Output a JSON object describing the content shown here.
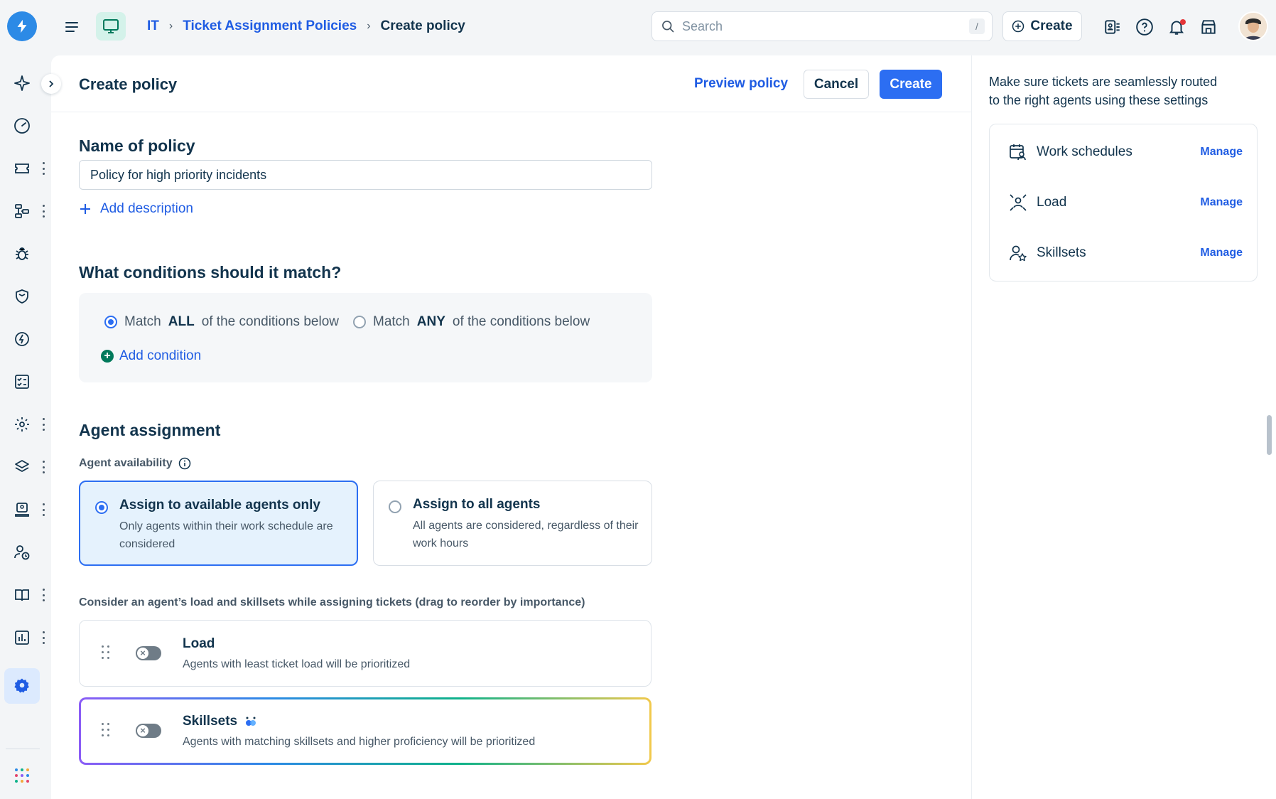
{
  "topbar": {
    "breadcrumb": [
      "IT",
      "Ticket Assignment Policies",
      "Create policy"
    ],
    "search_placeholder": "Search",
    "search_shortcut": "/",
    "create_label": "Create"
  },
  "leftnav": {
    "items": [
      "sparkle-icon",
      "dashboard-icon",
      "ticket-icon",
      "workflow-icon",
      "bug-icon",
      "shield-icon",
      "change-icon",
      "tasks-icon",
      "config-icon",
      "layers-icon",
      "assets-icon",
      "user-clock-icon",
      "book-icon",
      "reports-icon",
      "settings-icon",
      "apps-grid-icon"
    ]
  },
  "header": {
    "title": "Create policy",
    "preview_label": "Preview policy",
    "cancel_label": "Cancel",
    "create_label": "Create"
  },
  "name_section": {
    "title": "Name of policy",
    "value": "Policy for high priority incidents",
    "add_description": "Add description"
  },
  "conditions": {
    "title": "What conditions should it match?",
    "match_all_prefix": "Match",
    "match_all_bold": "ALL",
    "match_all_suffix": "of the conditions below",
    "match_any_prefix": "Match",
    "match_any_bold": "ANY",
    "match_any_suffix": "of the conditions below",
    "selected": "all",
    "add_condition": "Add condition"
  },
  "assignment": {
    "title": "Agent assignment",
    "availability_label": "Agent availability",
    "options": [
      {
        "title": "Assign to available agents only",
        "desc": "Only agents within their work schedule are considered",
        "selected": true
      },
      {
        "title": "Assign to all agents",
        "desc": "All agents are considered, regardless of their work hours",
        "selected": false
      }
    ],
    "consider_label": "Consider an agent’s load and skillsets while assigning tickets (drag to reorder by importance)",
    "factors": [
      {
        "title": "Load",
        "desc": "Agents with least ticket load will be prioritized",
        "enabled": false
      },
      {
        "title": "Skillsets",
        "desc": "Agents with matching skillsets and higher proficiency will be prioritized",
        "enabled": false
      }
    ]
  },
  "right_panel": {
    "intro": "Make sure tickets are seamlessly routed to the right agents using these settings",
    "settings": [
      {
        "label": "Work schedules",
        "action": "Manage",
        "icon": "calendar-user-icon"
      },
      {
        "label": "Load",
        "action": "Manage",
        "icon": "load-icon"
      },
      {
        "label": "Skillsets",
        "action": "Manage",
        "icon": "user-star-icon"
      }
    ]
  },
  "colors": {
    "primary": "#2c6ef2",
    "link": "#1f5ce3",
    "text": "#12344d",
    "selected_card_bg": "#e5f2fd"
  }
}
